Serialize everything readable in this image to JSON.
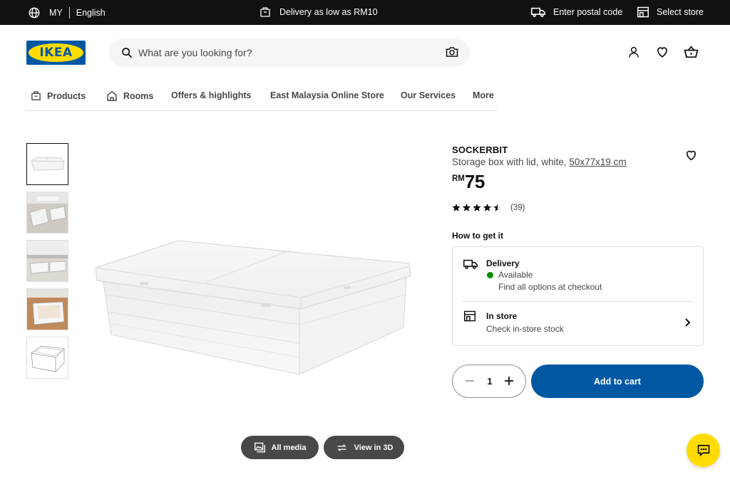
{
  "topbar": {
    "country": "MY",
    "language": "English",
    "delivery_promo": "Delivery as low as RM10",
    "postal_code": "Enter postal code",
    "store": "Select store"
  },
  "brand": {
    "logo_text": "IKEA",
    "brand_yellow": "#ffdb00",
    "brand_blue": "#0058a3"
  },
  "search": {
    "placeholder": "What are you looking for?"
  },
  "nav": {
    "items": [
      "Products",
      "Rooms",
      "Offers & highlights",
      "East Malaysia Online Store",
      "Our Services",
      "More"
    ]
  },
  "gallery": {
    "thumbnails": [
      "product-white",
      "under-bed-open",
      "under-bed-closed",
      "box-with-linen",
      "line-drawing"
    ],
    "selected_index": 0,
    "buttons": {
      "all_media": "All media",
      "view_3d": "View in 3D"
    }
  },
  "product": {
    "name": "SOCKERBIT",
    "description": "Storage box with lid, white, ",
    "dimensions": "50x77x19 cm",
    "currency": "RM",
    "price": "75",
    "rating_value": 4.5,
    "review_count": "(39)"
  },
  "availability": {
    "heading": "How to get it",
    "delivery_title": "Delivery",
    "delivery_status": "Available",
    "delivery_note": "Find all options at checkout",
    "status_color": "#0a8a00",
    "store_title": "In store",
    "store_note": "Check in-store stock"
  },
  "purchase": {
    "quantity": "1",
    "add_to_cart": "Add to cart"
  }
}
